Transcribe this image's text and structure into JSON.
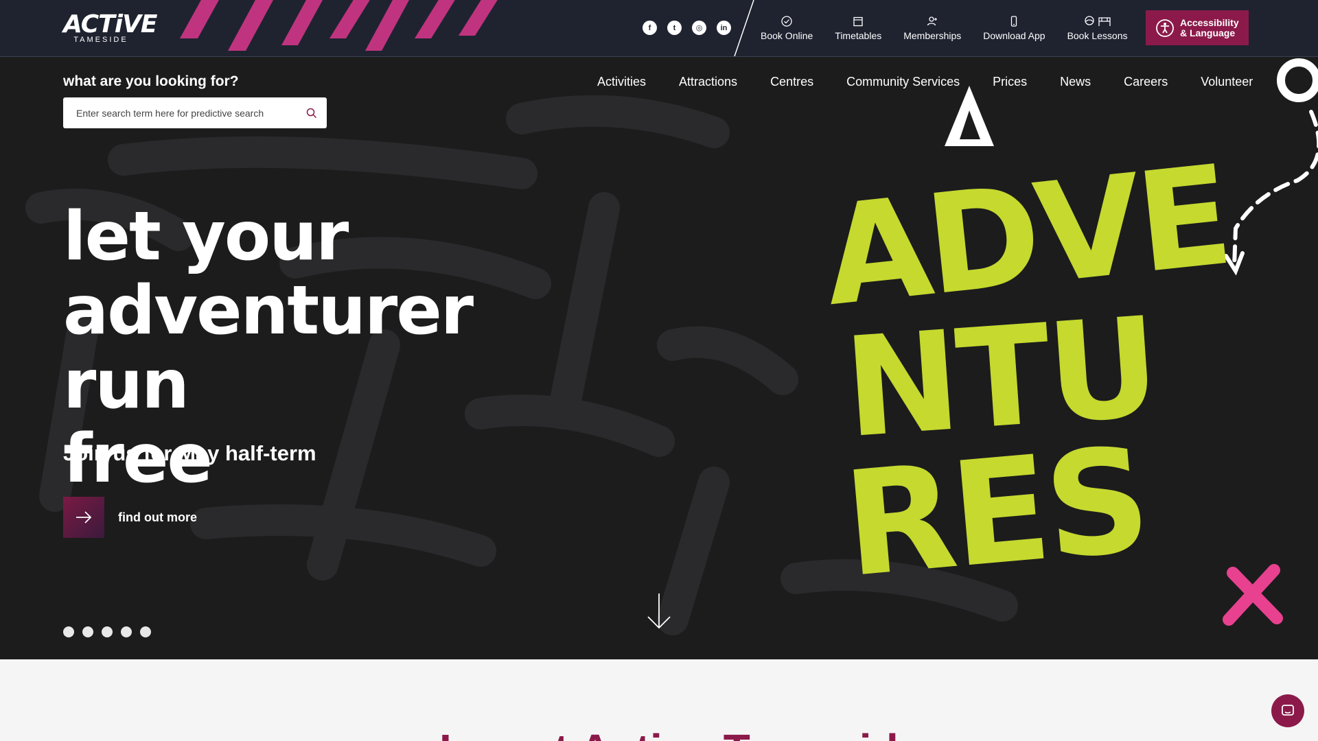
{
  "brand": {
    "logo_text": "ACTiVE",
    "logo_sub": "TAMESIDE"
  },
  "social": [
    {
      "name": "facebook-icon",
      "glyph": "f"
    },
    {
      "name": "twitter-icon",
      "glyph": "t"
    },
    {
      "name": "instagram-icon",
      "glyph": "◎"
    },
    {
      "name": "linkedin-icon",
      "glyph": "in"
    }
  ],
  "quick_links": {
    "book_online": "Book Online",
    "timetables": "Timetables",
    "memberships": "Memberships",
    "download_app": "Download App",
    "book_lessons": "Book Lessons"
  },
  "accessibility": {
    "line1": "Accessibility",
    "line2": "& Language"
  },
  "search": {
    "label": "what are you looking for?",
    "placeholder": "Enter search term here for predictive search"
  },
  "nav": {
    "activities": "Activities",
    "attractions": "Attractions",
    "centres": "Centres",
    "community": "Community Services",
    "prices": "Prices",
    "news": "News",
    "careers": "Careers",
    "volunteer": "Volunteer"
  },
  "hero": {
    "line1": "let your",
    "line2": "adventurer run",
    "line3": "free",
    "subhead": "Join us for May half-term",
    "cta_label": "find out more",
    "slide_count": 5,
    "art_word_1": "ADVE",
    "art_word_2": "NTU",
    "art_word_3": "RES"
  },
  "below": {
    "title_partial": "Lo eet Active Tamesid"
  },
  "colors": {
    "topbar": "#1f2330",
    "hero_bg": "#1c1c1d",
    "accent": "#8b1a4a",
    "stripe_pink": "#c0347f",
    "lime": "#c5d92f",
    "pink_x": "#e8418f"
  }
}
